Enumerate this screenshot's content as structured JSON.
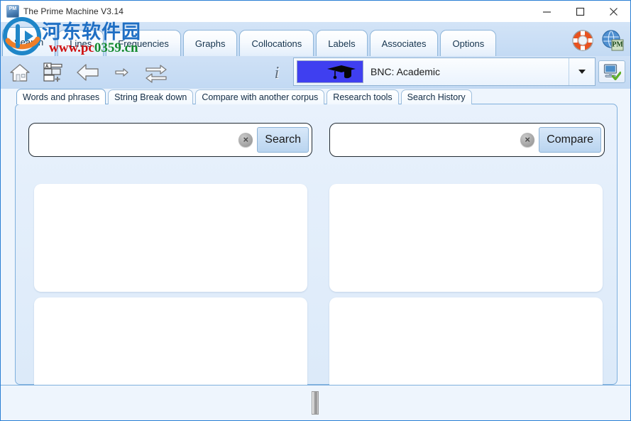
{
  "window": {
    "title": "The Prime Machine V3.14",
    "app_icon": "pm-app-icon",
    "controls": {
      "minimize": "minimize-button",
      "maximize": "maximize-button",
      "close": "close-button"
    }
  },
  "main_tabs": {
    "active": "Search",
    "items": [
      {
        "label": "Search"
      },
      {
        "label": "Lines"
      },
      {
        "label": "Frequencies"
      },
      {
        "label": "Graphs"
      },
      {
        "label": "Collocations"
      },
      {
        "label": "Labels"
      },
      {
        "label": "Associates"
      },
      {
        "label": "Options"
      }
    ],
    "right_icons": [
      {
        "name": "help-lifebuoy-icon"
      },
      {
        "name": "globe-pm-icon"
      }
    ]
  },
  "toolbar": {
    "buttons": [
      {
        "name": "home-icon",
        "label": "Home"
      },
      {
        "name": "new-tab-icon",
        "label": "New card"
      },
      {
        "name": "back-arrow-icon",
        "label": "Back"
      },
      {
        "name": "forward-arrow-icon",
        "label": "Forward"
      },
      {
        "name": "swap-arrows-icon",
        "label": "Swap"
      }
    ],
    "info_icon": "info-icon",
    "corpus": {
      "selected": "BNC: Academic",
      "swatch_color": "#3f3ff0",
      "swatch_icon": "graduation-cap-icon",
      "dropdown_icon": "chevron-down-icon"
    },
    "connection": {
      "name": "server-connected-icon",
      "status": "connected"
    }
  },
  "sub_tabs": {
    "active": "Words and phrases",
    "items": [
      {
        "label": "Words and phrases"
      },
      {
        "label": "String Break down"
      },
      {
        "label": "Compare with another corpus"
      },
      {
        "label": "Research tools"
      },
      {
        "label": "Search History"
      }
    ]
  },
  "search_panel": {
    "left": {
      "input_value": "",
      "input_placeholder": "",
      "clear_label": "×",
      "button_label": "Search"
    },
    "right": {
      "input_value": "",
      "input_placeholder": "",
      "clear_label": "×",
      "button_label": "Compare"
    },
    "results": {
      "left_top": "",
      "left_bottom": "",
      "right_top": "",
      "right_bottom": ""
    }
  },
  "status_bar": {
    "text": "",
    "splitter": "vertical-splitter-grip"
  },
  "watermark": {
    "site_cn": "河东软件园",
    "url_prefix": "www.pc",
    "url_mid": "0359",
    "url_suffix": ".cn",
    "logo": "hedong-logo"
  },
  "colors": {
    "accent": "#2a7fd4",
    "tab_bg": "#c3daf4",
    "panel_bg": "#e8f1fc",
    "corpus_swatch": "#3f3ff0"
  }
}
